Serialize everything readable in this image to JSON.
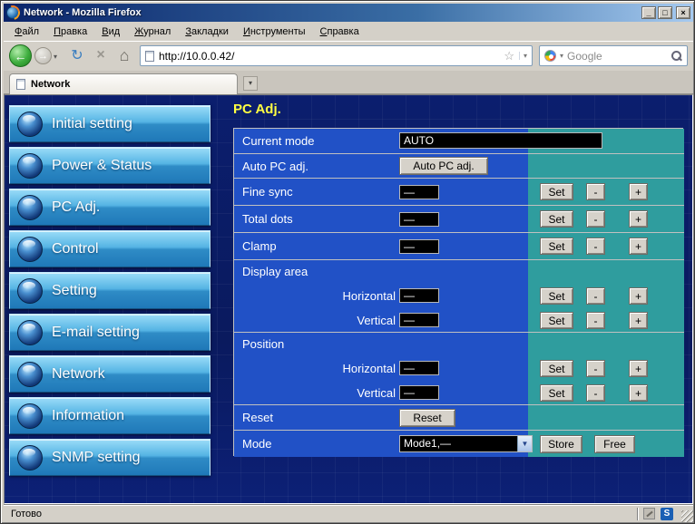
{
  "window": {
    "title": "Network - Mozilla Firefox"
  },
  "icons": {
    "back": "←",
    "forward": "→",
    "refresh": "↻",
    "stop": "×",
    "home": "⌂",
    "star": "☆",
    "caret_down": "▾",
    "select_arrow": "▼",
    "minimize": "_",
    "maximize": "□",
    "close": "×"
  },
  "menubar": {
    "items": [
      "Файл",
      "Правка",
      "Вид",
      "Журнал",
      "Закладки",
      "Инструменты",
      "Справка"
    ]
  },
  "toolbar": {
    "url": "http://10.0.0.42/",
    "search_text": "Google"
  },
  "tabbar": {
    "tabs": [
      {
        "label": "Network"
      }
    ]
  },
  "sidebar": {
    "items": [
      {
        "label": "Initial setting"
      },
      {
        "label": "Power & Status"
      },
      {
        "label": "PC Adj."
      },
      {
        "label": "Control"
      },
      {
        "label": "Setting"
      },
      {
        "label": "E-mail setting"
      },
      {
        "label": "Network"
      },
      {
        "label": "Information"
      },
      {
        "label": "SNMP setting"
      }
    ]
  },
  "panel": {
    "title": "PC Adj.",
    "current_mode": {
      "label": "Current mode",
      "value": "AUTO"
    },
    "auto_pc": {
      "label": "Auto PC adj.",
      "button": "Auto PC adj."
    },
    "fine_sync": {
      "label": "Fine sync",
      "value": "—"
    },
    "total_dots": {
      "label": "Total dots",
      "value": "—"
    },
    "clamp": {
      "label": "Clamp",
      "value": "—"
    },
    "display_area": {
      "label": "Display area",
      "rows": [
        {
          "label": "Horizontal",
          "value": "—"
        },
        {
          "label": "Vertical",
          "value": "—"
        }
      ]
    },
    "position": {
      "label": "Position",
      "rows": [
        {
          "label": "Horizontal",
          "value": "—"
        },
        {
          "label": "Vertical",
          "value": "—"
        }
      ]
    },
    "reset": {
      "label": "Reset",
      "button": "Reset"
    },
    "mode": {
      "label": "Mode",
      "value": "Mode1,—",
      "store": "Store",
      "free": "Free"
    },
    "controls": {
      "set": "Set",
      "minus": "-",
      "plus": "+"
    }
  },
  "statusbar": {
    "text": "Готово",
    "s_badge": "S"
  },
  "colors": {
    "row_blue": "#2151c6",
    "row_teal": "#2f9d9e",
    "title_yellow": "#ffff42",
    "sidebar_top": "#9bdcf8",
    "sidebar_bottom": "#1f78b8",
    "page_bg": "#0b1e6e",
    "titlebar_left": "#0a246a",
    "titlebar_right": "#a6caf0"
  }
}
